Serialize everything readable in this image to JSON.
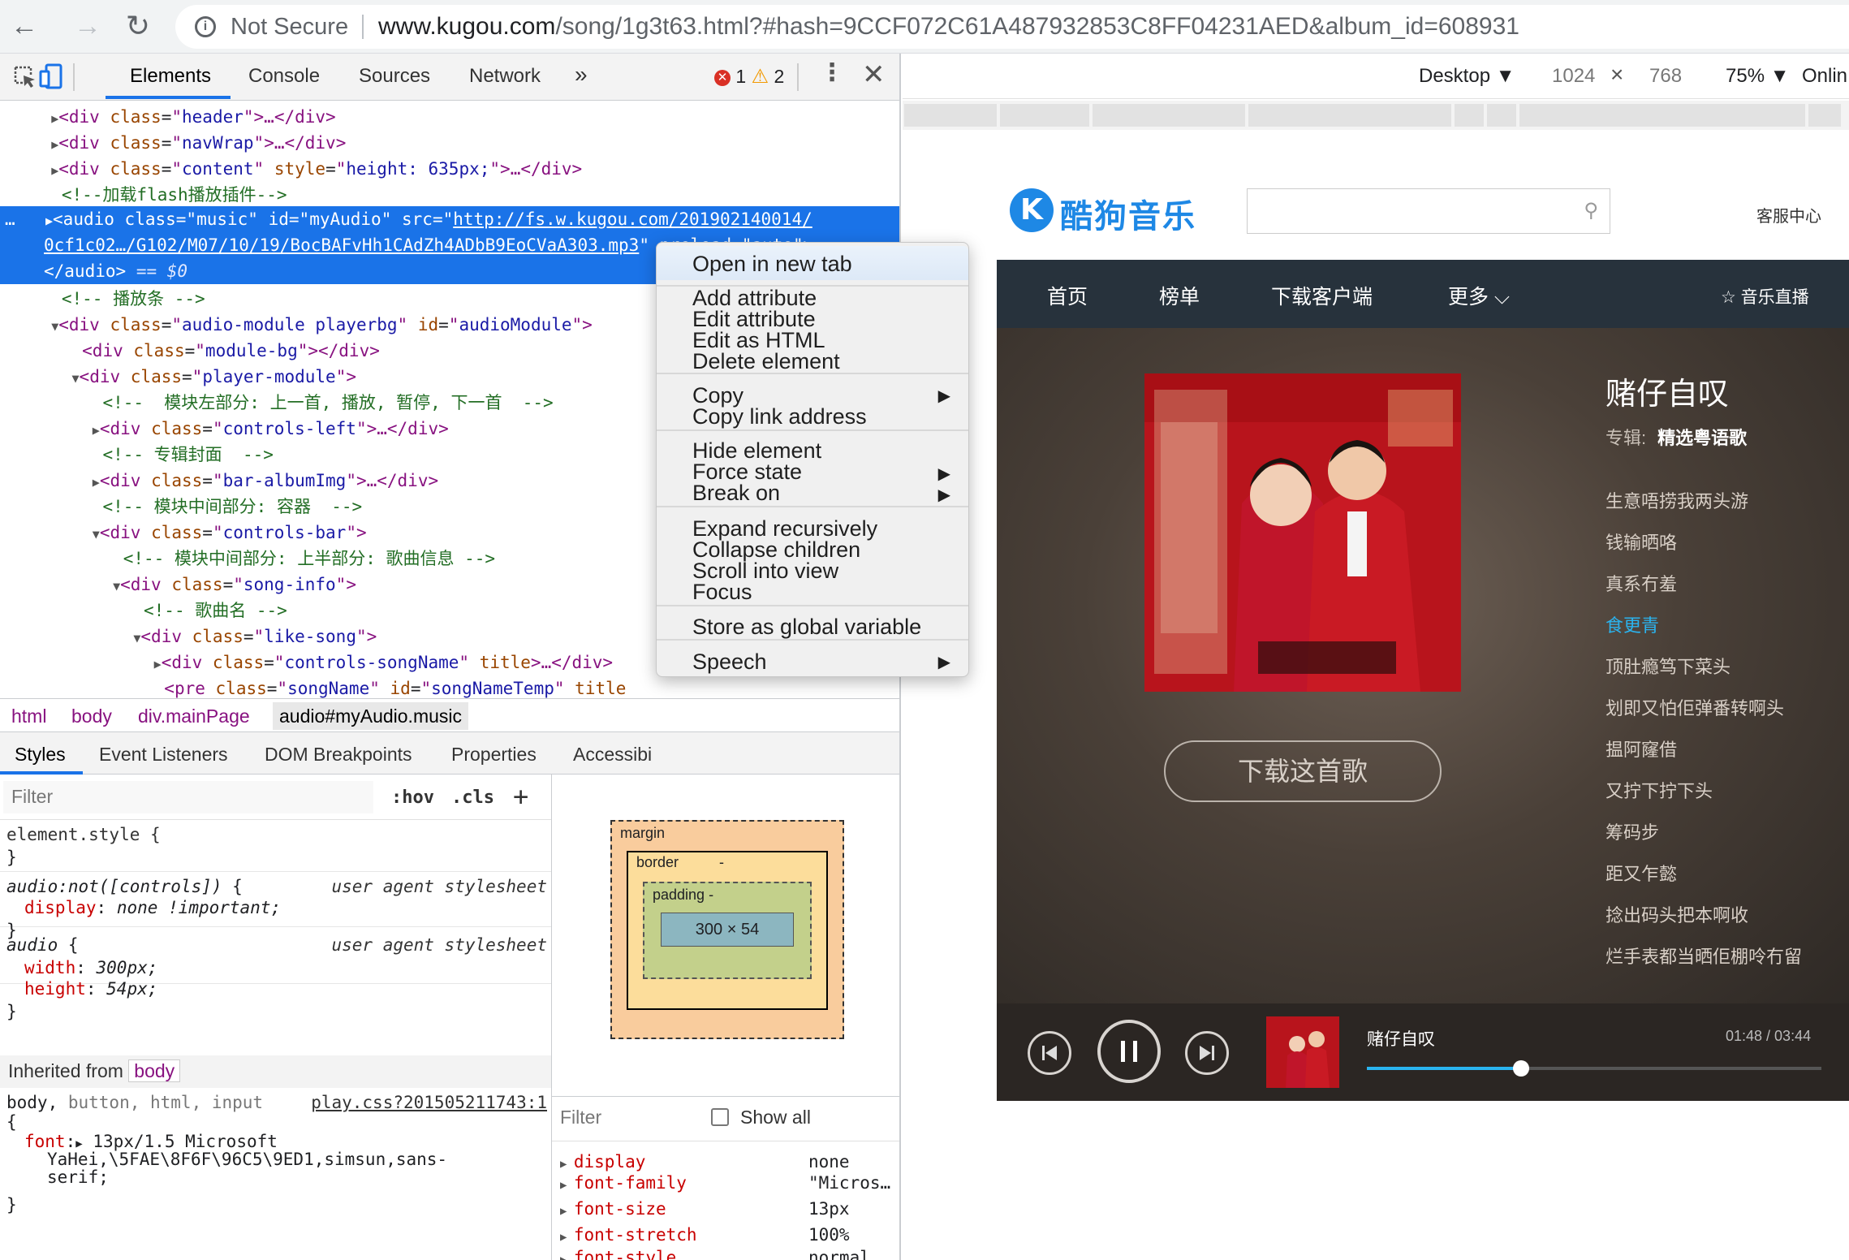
{
  "browser": {
    "not_secure": "Not Secure",
    "url_host": "www.kugou.com",
    "url_path": "/song/1g3t63.html?#hash=9CCF072C61A487932853C8FF04231AED&album_id=608931"
  },
  "devtools": {
    "tabs": [
      "Elements",
      "Console",
      "Sources",
      "Network"
    ],
    "more": "»",
    "errors": "1",
    "warnings": "2",
    "dom": {
      "l1_attr": "header",
      "l2_attr": "navWrap",
      "l3_attr": "content",
      "l3_style": "height: 635px;",
      "l4_comment": "<!--加载flash播放插件-->",
      "l5_src": "http://fs.w.kugou.com/201902140014/",
      "l6_src": "0cf1c02…/G102/M07/10/19/BocBAFvHh1CAdZh4ADbB9EoCVaA303.mp3",
      "l7_eq": "== $0",
      "l8_comment": "<!-- 播放条 -->",
      "l9_class": "audio-module playerbg",
      "l9_id": "audioModule",
      "l10_class": "module-bg",
      "l11_class": "player-module",
      "l12_comment": "<!--  模块左部分: 上一首, 播放, 暂停, 下一首  -->",
      "l13_class": "controls-left",
      "l14_comment": "<!-- 专辑封面  -->",
      "l15_class": "bar-albumImg",
      "l16_comment": "<!-- 模块中间部分: 容器  -->",
      "l17_class": "controls-bar",
      "l18_comment": "<!-- 模块中间部分: 上半部分: 歌曲信息 -->",
      "l19_class": "song-info",
      "l20_comment": "<!-- 歌曲名 -->",
      "l21_class": "like-song",
      "l22_class": "controls-songName",
      "l23_class": "songName",
      "l23_id": "songNameTemp"
    },
    "breadcrumbs": [
      "html",
      "body",
      "div.mainPage",
      "audio#myAudio.music"
    ],
    "styles_tabs": [
      "Styles",
      "Event Listeners",
      "DOM Breakpoints",
      "Properties",
      "Accessibi"
    ],
    "filter_placeholder": "Filter",
    "hov": ":hov",
    "cls": ".cls",
    "ua_label": "user agent stylesheet",
    "inherited_from": "Inherited from",
    "inherited_tag": "body",
    "body_rule_source": "play.css?201505211743:1",
    "box_model": {
      "margin": "margin",
      "border": "border",
      "padding": "padding -",
      "content": "300 × 54",
      "dash": "-"
    },
    "show_all": "Show all",
    "computed": [
      {
        "prop": "display",
        "val": "none"
      },
      {
        "prop": "font-family",
        "val": "\"Micros…"
      },
      {
        "prop": "font-size",
        "val": "13px"
      },
      {
        "prop": "font-stretch",
        "val": "100%"
      },
      {
        "prop": "font-style",
        "val": "normal"
      }
    ]
  },
  "context_menu": {
    "open_new_tab": "Open in new tab",
    "add_attribute": "Add attribute",
    "edit_attribute": "Edit attribute",
    "edit_html": "Edit as HTML",
    "delete_element": "Delete element",
    "copy": "Copy",
    "copy_link": "Copy link address",
    "hide_element": "Hide element",
    "force_state": "Force state",
    "break_on": "Break on",
    "expand_recursively": "Expand recursively",
    "collapse_children": "Collapse children",
    "scroll_into_view": "Scroll into view",
    "focus": "Focus",
    "store_global": "Store as global variable",
    "speech": "Speech",
    "submenu_arrow": "▶"
  },
  "device_toolbar": {
    "device": "Desktop ▼",
    "width": "1024",
    "times": "×",
    "height": "768",
    "zoom": "75% ▼",
    "throttle": "Onlin"
  },
  "kugou": {
    "logo_k": "K",
    "logo_text": "酷狗音乐",
    "service": "客服中心",
    "nav": [
      "首页",
      "榜单",
      "下载客户端",
      "更多 ⌵"
    ],
    "nav_right": "☆ 音乐直播",
    "download_btn": "下载这首歌",
    "song_title": "赌仔自叹",
    "album_prefix": "专辑:",
    "album_name": "精选粤语歌",
    "lyrics": [
      "生意唔捞我两头游",
      "钱输晒咯",
      "真系冇羞",
      "食更青",
      "顶肚瘾笃下菜头",
      "划即又怕佢弹番转啊头",
      "揾阿窿借",
      "又拧下拧下头",
      "筹码步",
      "距又乍懿",
      "捻出码头把本啊收",
      "烂手表都当晒佢棚呤冇留"
    ],
    "active_lyric_index": 3,
    "player_song": "赌仔自叹",
    "player_time": "01:48 / 03:44",
    "progress": 0.34
  }
}
